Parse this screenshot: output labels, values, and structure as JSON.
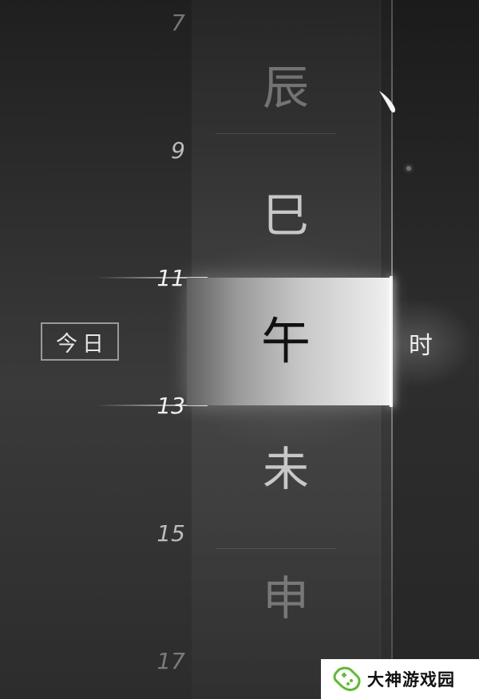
{
  "today_button": {
    "label": "今日"
  },
  "hour_unit": "时",
  "branches": [
    {
      "char": "辰",
      "state": "faded"
    },
    {
      "char": "巳",
      "state": "normal"
    },
    {
      "char": "午",
      "state": "active"
    },
    {
      "char": "未",
      "state": "normal"
    },
    {
      "char": "申",
      "state": "faded"
    }
  ],
  "hour_ticks": [
    "7",
    "9",
    "11",
    "13",
    "15",
    "17"
  ],
  "watermark": {
    "text": "大神游戏园",
    "logo_icon": "gamepad-icon"
  },
  "colors": {
    "highlight": "#e2e2e2",
    "active_text": "#111111",
    "brand_green": "#5bbd2b"
  }
}
